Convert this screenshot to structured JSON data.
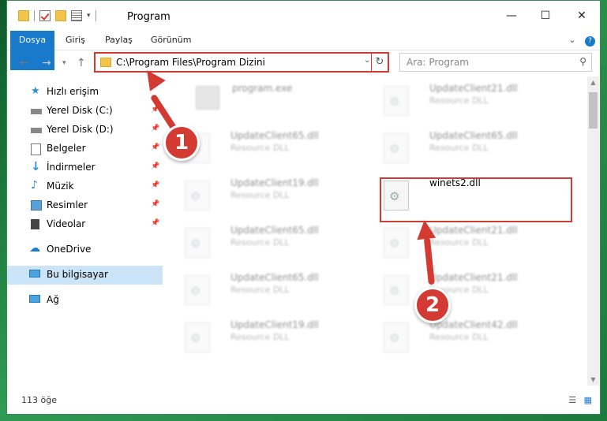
{
  "window": {
    "title": "Program",
    "controls": {
      "minimize": "—",
      "maximize": "☐",
      "close": "✕"
    }
  },
  "ribbon": {
    "tabs": [
      "Dosya",
      "Giriş",
      "Paylaş",
      "Görünüm"
    ],
    "expand_icon": "chevron-down-icon",
    "help": "?"
  },
  "address": {
    "path": "C:\\Program Files\\Program Dizini",
    "search_placeholder": "Ara: Program"
  },
  "nav": {
    "items": [
      {
        "label": "Hızlı erişim",
        "icon": "star-icon",
        "pinned": false
      },
      {
        "label": "Yerel Disk (C:)",
        "icon": "drive-icon",
        "pinned": true
      },
      {
        "label": "Yerel Disk (D:)",
        "icon": "drive-icon",
        "pinned": true
      },
      {
        "label": "Belgeler",
        "icon": "documents-icon",
        "pinned": true
      },
      {
        "label": "İndirmeler",
        "icon": "download-icon",
        "pinned": true
      },
      {
        "label": "Müzik",
        "icon": "music-icon",
        "pinned": true
      },
      {
        "label": "Resimler",
        "icon": "pictures-icon",
        "pinned": true
      },
      {
        "label": "Videolar",
        "icon": "video-icon",
        "pinned": true
      },
      {
        "label": "OneDrive",
        "icon": "cloud-icon",
        "pinned": false
      },
      {
        "label": "Bu bilgisayar",
        "icon": "computer-icon",
        "pinned": false,
        "selected": true
      },
      {
        "label": "Ağ",
        "icon": "network-icon",
        "pinned": false
      }
    ]
  },
  "files": [
    {
      "name": "program.exe",
      "type": ""
    },
    {
      "name": "UpdateClient21.dll",
      "type": "Resource DLL"
    },
    {
      "name": "UpdateClient65.dll",
      "type": "Resource DLL"
    },
    {
      "name": "UpdateClient65.dll",
      "type": "Resource DLL"
    },
    {
      "name": "UpdateClient19.dll",
      "type": "Resource DLL"
    },
    {
      "name": "winets2.dll",
      "type": "",
      "highlighted": true
    },
    {
      "name": "UpdateClient65.dll",
      "type": "Resource DLL"
    },
    {
      "name": "UpdateClient21.dll",
      "type": "Resource DLL"
    },
    {
      "name": "UpdateClient65.dll",
      "type": "Resource DLL"
    },
    {
      "name": "UpdateClient21.dll",
      "type": "Resource DLL"
    },
    {
      "name": "UpdateClient19.dll",
      "type": "Resource DLL"
    },
    {
      "name": "UpdateClient42.dll",
      "type": "Resource DLL"
    }
  ],
  "status": {
    "count": "113 öğe"
  },
  "callouts": [
    "1",
    "2"
  ],
  "colors": {
    "accent": "#1979ca",
    "callout": "#d23a32",
    "selected": "#cce4f7"
  }
}
